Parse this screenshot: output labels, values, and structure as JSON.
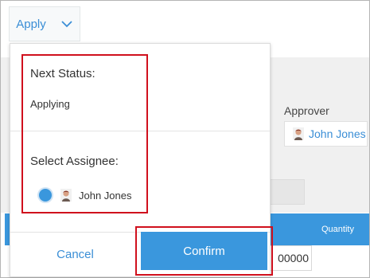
{
  "toolbar": {
    "apply_label": "Apply"
  },
  "background": {
    "approver_label": "Approver",
    "approver_name": "John Jones",
    "table_header_quantity": "Quantity",
    "cell_value": "00000"
  },
  "dropdown": {
    "next_status_label": "Next Status:",
    "next_status_value": "Applying",
    "select_assignee_label": "Select Assignee:",
    "assignee_name": "John Jones",
    "assignee_selected": true,
    "cancel_label": "Cancel",
    "confirm_label": "Confirm"
  },
  "colors": {
    "accent": "#3a97dd",
    "link": "#3a8ed6",
    "highlight": "#d0101d"
  },
  "icons": {
    "apply_chevron": "chevron-down-icon",
    "avatar": "user-avatar"
  }
}
